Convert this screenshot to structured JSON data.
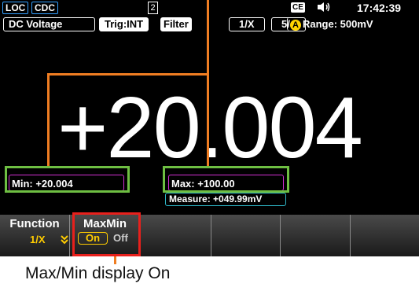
{
  "status_bar": {
    "loc_badge": "LOC",
    "cdc_badge": "CDC",
    "page_number": "2",
    "storage_icon": "CE",
    "clock": "17:42:39"
  },
  "info_bar": {
    "mode": "DC Voltage",
    "trigger": "Trig:INT",
    "filter": "Filter",
    "rate": "1/X",
    "interval": "5/s",
    "range_prefix": "A",
    "range": "Range: 500mV"
  },
  "reading": "+20.004",
  "min_field": "Min: +20.004",
  "max_field": "Max: +100.00",
  "measure_field": "Measure: +049.99mV",
  "softkeys": {
    "function_label": "Function",
    "function_value": "1/X",
    "maxmin_label": "MaxMin",
    "maxmin_on": "On",
    "maxmin_off": "Off"
  },
  "caption": "Max/Min display On",
  "colors": {
    "annotation_orange": "#ef7d22",
    "highlight_green": "#6ebe42",
    "highlight_red": "#e8201c",
    "field_magenta": "#d22fd2",
    "measure_cyan": "#2fb9c9",
    "softkey_value": "#ffcc00"
  }
}
